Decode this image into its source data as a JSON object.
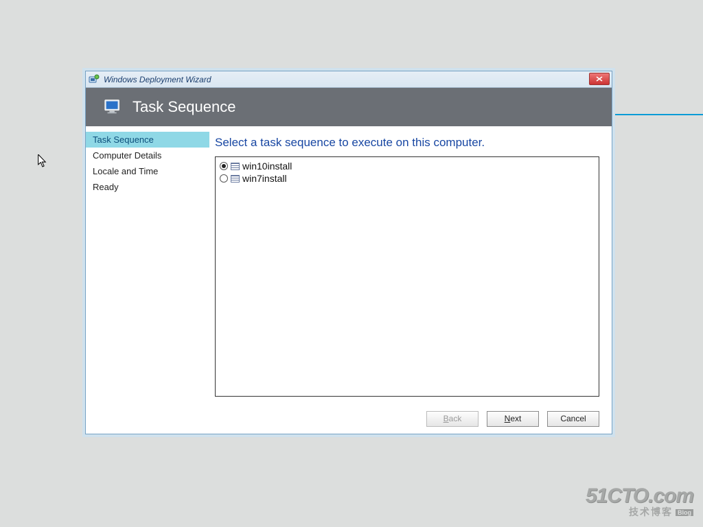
{
  "window": {
    "title": "Windows Deployment Wizard"
  },
  "header": {
    "title": "Task Sequence"
  },
  "sidebar": {
    "items": [
      {
        "label": "Task Sequence",
        "active": true
      },
      {
        "label": "Computer Details",
        "active": false
      },
      {
        "label": "Locale and Time",
        "active": false
      },
      {
        "label": "Ready",
        "active": false
      }
    ]
  },
  "main": {
    "instruction": "Select a task sequence to execute on this computer.",
    "options": [
      {
        "label": "win10install",
        "selected": true
      },
      {
        "label": "win7install",
        "selected": false
      }
    ]
  },
  "footer": {
    "back": "Back",
    "next": "Next",
    "cancel": "Cancel",
    "back_enabled": false
  },
  "watermark": {
    "main": "51CTO.com",
    "sub": "技术博客",
    "blog": "Blog"
  }
}
